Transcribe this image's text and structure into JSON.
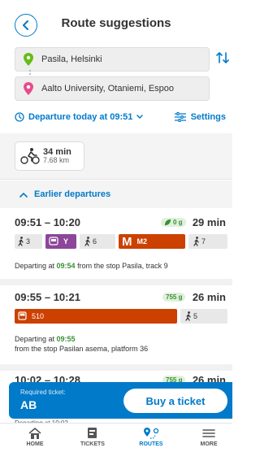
{
  "header": {
    "title": "Route suggestions"
  },
  "locations": {
    "origin": "Pasila, Helsinki",
    "destination": "Aalto University, Otaniemi, Espoo"
  },
  "departure": {
    "label": "Departure today at 09:51",
    "settings_label": "Settings"
  },
  "modes": {
    "bike_duration": "34 min",
    "bike_distance": "7.68 km"
  },
  "earlier": {
    "label": "Earlier departures"
  },
  "itineraries": [
    {
      "times": "09:51 – 10:20",
      "duration": "29 min",
      "co2": "0 g",
      "legs": [
        {
          "type": "walk",
          "label": "3"
        },
        {
          "type": "train",
          "label": "Y"
        },
        {
          "type": "walk",
          "label": "6"
        },
        {
          "type": "metro",
          "label": "M2"
        },
        {
          "type": "walk",
          "label": "7"
        }
      ],
      "info_prefix": "Departing at",
      "info_time": "09:54",
      "info_suffix": "from the stop Pasila, track 9"
    },
    {
      "times": "09:55 – 10:21",
      "duration": "26 min",
      "co2": "755 g",
      "legs": [
        {
          "type": "bus",
          "label": "510"
        },
        {
          "type": "walk",
          "label": "5"
        }
      ],
      "info_prefix": "Departing at",
      "info_time": "09:55",
      "info_suffix": "from the stop Pasilan asema, platform 36"
    },
    {
      "times": "10:02 – 10:28",
      "duration": "26 min",
      "co2": "755 g"
    }
  ],
  "ticket": {
    "required_label": "Required ticket:",
    "zone": "AB",
    "buy_label": "Buy a ticket",
    "peek_text": "Departing at 10:02"
  },
  "tabs": [
    {
      "label": "HOME",
      "icon": "home-icon"
    },
    {
      "label": "TICKETS",
      "icon": "tickets-icon"
    },
    {
      "label": "ROUTES",
      "icon": "routes-icon",
      "active": true
    },
    {
      "label": "MORE",
      "icon": "menu-icon"
    }
  ],
  "colors": {
    "primary": "#007ac9",
    "bus": "#cc4000",
    "metro": "#cc4000",
    "train": "#8c4799",
    "co2": "#3b8f35",
    "origin_pin": "#64be14",
    "destination_pin": "#e84b8a"
  }
}
